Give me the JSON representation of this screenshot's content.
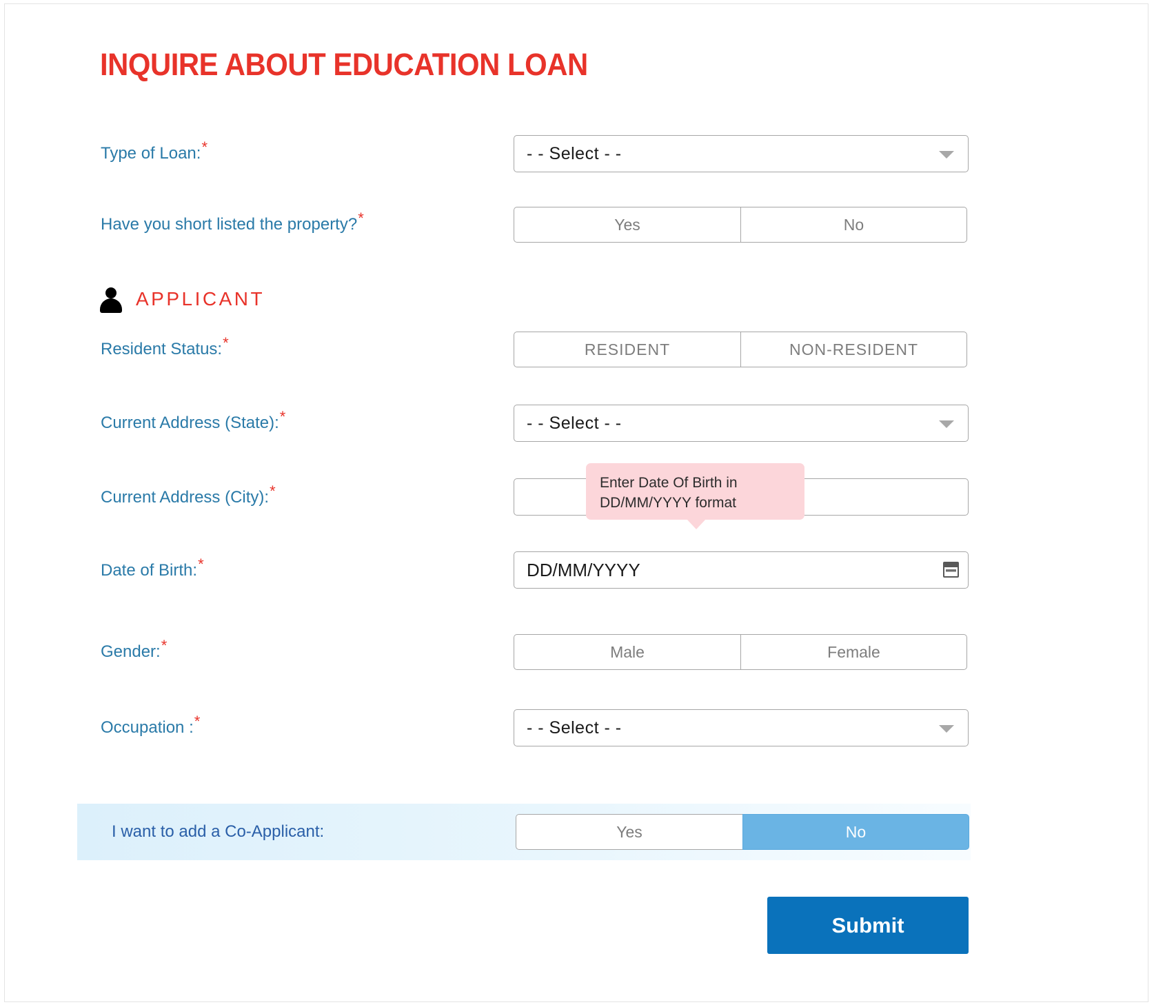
{
  "form": {
    "title": "INQUIRE ABOUT EDUCATION LOAN",
    "required_marker": "*",
    "section": {
      "icon": "person-icon",
      "label": "APPLICANT"
    },
    "fields": [
      {
        "key": "type_of_loan",
        "label": "Type of Loan:",
        "control": "select",
        "value": "- - Select - -"
      },
      {
        "key": "short_listed_property",
        "label": "Have you short listed the property?",
        "control": "toggle",
        "options": [
          "Yes",
          "No"
        ],
        "selected": null
      },
      {
        "key": "resident_status",
        "label": "Resident Status:",
        "control": "toggle",
        "options": [
          "RESIDENT",
          "NON-RESIDENT"
        ],
        "selected": null
      },
      {
        "key": "current_address_state",
        "label": "Current Address (State):",
        "control": "select",
        "value": "- - Select - -"
      },
      {
        "key": "current_address_city",
        "label": "Current Address (City):",
        "control": "text",
        "value": "",
        "placeholder": ""
      },
      {
        "key": "date_of_birth",
        "label": "Date of Birth:",
        "control": "text",
        "value": "",
        "placeholder": "DD/MM/YYYY",
        "icon": "calendar-icon"
      },
      {
        "key": "gender",
        "label": "Gender:",
        "control": "toggle",
        "options": [
          "Male",
          "Female"
        ],
        "selected": null
      },
      {
        "key": "occupation",
        "label": "Occupation :",
        "control": "select",
        "value": "- - Select - -"
      }
    ],
    "tooltip": {
      "line1": "Enter Date Of Birth in",
      "line2": "DD/MM/YYYY format"
    },
    "co_applicant": {
      "label": "I want to add a Co-Applicant:",
      "options": [
        "Yes",
        "No"
      ],
      "selected": "No"
    },
    "submit_label": "Submit"
  },
  "colors": {
    "title_red": "#e8332a",
    "label_blue": "#2a7aa8",
    "coapplicant_label_blue": "#2a5fa8",
    "toggle_selected_blue": "#6ab4e4",
    "submit_blue": "#0a72bb",
    "tooltip_pink": "#fcd6da",
    "border_gray": "#a6a6a6"
  }
}
